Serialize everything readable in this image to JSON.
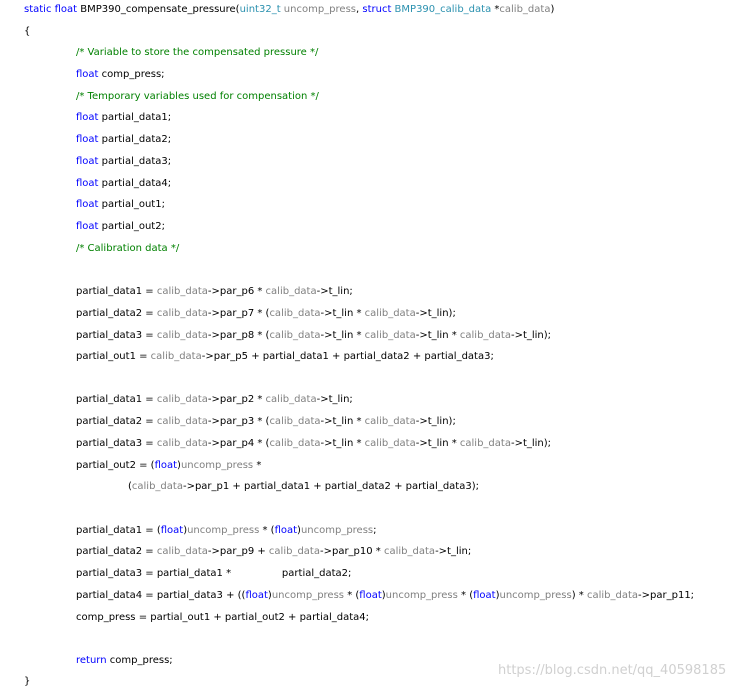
{
  "colors": {
    "keyword": "#0000ff",
    "type": "#2b91af",
    "variable": "#808080",
    "comment": "#008000",
    "text": "#000000",
    "watermark": "#d0d0d0"
  },
  "code_lines": [
    [
      [
        "kw",
        "static float "
      ],
      [
        "tx",
        "BMP390_compensate_pressure("
      ],
      [
        "ty",
        "uint32_t"
      ],
      [
        "vr",
        " uncomp_press"
      ],
      [
        "tx",
        ", "
      ],
      [
        "kw",
        "struct "
      ],
      [
        "ty",
        "BMP390_calib_data"
      ],
      [
        "tx",
        " *"
      ],
      [
        "vr",
        "calib_data"
      ],
      [
        "tx",
        ")"
      ]
    ],
    [
      [
        "tx",
        "{"
      ]
    ],
    [
      [
        "cm",
        "/* Variable to store the compensated pressure */"
      ]
    ],
    [
      [
        "kw",
        "float "
      ],
      [
        "tx",
        "comp_press;"
      ]
    ],
    [
      [
        "cm",
        "/* Temporary variables used for compensation */"
      ]
    ],
    [
      [
        "kw",
        "float "
      ],
      [
        "tx",
        "partial_data1;"
      ]
    ],
    [
      [
        "kw",
        "float "
      ],
      [
        "tx",
        "partial_data2;"
      ]
    ],
    [
      [
        "kw",
        "float "
      ],
      [
        "tx",
        "partial_data3;"
      ]
    ],
    [
      [
        "kw",
        "float "
      ],
      [
        "tx",
        "partial_data4;"
      ]
    ],
    [
      [
        "kw",
        "float "
      ],
      [
        "tx",
        "partial_out1;"
      ]
    ],
    [
      [
        "kw",
        "float "
      ],
      [
        "tx",
        "partial_out2;"
      ]
    ],
    [
      [
        "cm",
        "/* Calibration data */"
      ]
    ],
    [
      [
        "tx",
        "partial_data1 = "
      ],
      [
        "vr",
        "calib_data"
      ],
      [
        "tx",
        "->par_p6 * "
      ],
      [
        "vr",
        "calib_data"
      ],
      [
        "tx",
        "->t_lin;"
      ]
    ],
    [
      [
        "tx",
        "partial_data2 = "
      ],
      [
        "vr",
        "calib_data"
      ],
      [
        "tx",
        "->par_p7 * ("
      ],
      [
        "vr",
        "calib_data"
      ],
      [
        "tx",
        "->t_lin * "
      ],
      [
        "vr",
        "calib_data"
      ],
      [
        "tx",
        "->t_lin);"
      ]
    ],
    [
      [
        "tx",
        "partial_data3 = "
      ],
      [
        "vr",
        "calib_data"
      ],
      [
        "tx",
        "->par_p8 * ("
      ],
      [
        "vr",
        "calib_data"
      ],
      [
        "tx",
        "->t_lin * "
      ],
      [
        "vr",
        "calib_data"
      ],
      [
        "tx",
        "->t_lin * "
      ],
      [
        "vr",
        "calib_data"
      ],
      [
        "tx",
        "->t_lin);"
      ]
    ],
    [
      [
        "tx",
        "partial_out1 = "
      ],
      [
        "vr",
        "calib_data"
      ],
      [
        "tx",
        "->par_p5 + partial_data1 + partial_data2 + partial_data3;"
      ]
    ],
    [
      [
        "tx",
        "partial_data1 = "
      ],
      [
        "vr",
        "calib_data"
      ],
      [
        "tx",
        "->par_p2 * "
      ],
      [
        "vr",
        "calib_data"
      ],
      [
        "tx",
        "->t_lin;"
      ]
    ],
    [
      [
        "tx",
        "partial_data2 = "
      ],
      [
        "vr",
        "calib_data"
      ],
      [
        "tx",
        "->par_p3 * ("
      ],
      [
        "vr",
        "calib_data"
      ],
      [
        "tx",
        "->t_lin * "
      ],
      [
        "vr",
        "calib_data"
      ],
      [
        "tx",
        "->t_lin);"
      ]
    ],
    [
      [
        "tx",
        "partial_data3 = "
      ],
      [
        "vr",
        "calib_data"
      ],
      [
        "tx",
        "->par_p4 * ("
      ],
      [
        "vr",
        "calib_data"
      ],
      [
        "tx",
        "->t_lin * "
      ],
      [
        "vr",
        "calib_data"
      ],
      [
        "tx",
        "->t_lin * "
      ],
      [
        "vr",
        "calib_data"
      ],
      [
        "tx",
        "->t_lin);"
      ]
    ],
    [
      [
        "tx",
        "partial_out2 = ("
      ],
      [
        "kw",
        "float"
      ],
      [
        "tx",
        ")"
      ],
      [
        "vr",
        "uncomp_press"
      ],
      [
        "tx",
        " *"
      ]
    ],
    [
      [
        "tx",
        "("
      ],
      [
        "vr",
        "calib_data"
      ],
      [
        "tx",
        "->par_p1 + partial_data1 + partial_data2 + partial_data3);"
      ]
    ],
    [
      [
        "tx",
        "partial_data1 = ("
      ],
      [
        "kw",
        "float"
      ],
      [
        "tx",
        ")"
      ],
      [
        "vr",
        "uncomp_press"
      ],
      [
        "tx",
        " * ("
      ],
      [
        "kw",
        "float"
      ],
      [
        "tx",
        ")"
      ],
      [
        "vr",
        "uncomp_press"
      ],
      [
        "tx",
        ";"
      ]
    ],
    [
      [
        "tx",
        "partial_data2 = "
      ],
      [
        "vr",
        "calib_data"
      ],
      [
        "tx",
        "->par_p9 + "
      ],
      [
        "vr",
        "calib_data"
      ],
      [
        "tx",
        "->par_p10 * "
      ],
      [
        "vr",
        "calib_data"
      ],
      [
        "tx",
        "->t_lin;"
      ]
    ],
    [
      [
        "tx",
        "partial_data3 = partial_data1 *                partial_data2;"
      ]
    ],
    [
      [
        "tx",
        "partial_data4 = partial_data3 + (("
      ],
      [
        "kw",
        "float"
      ],
      [
        "tx",
        ")"
      ],
      [
        "vr",
        "uncomp_press"
      ],
      [
        "tx",
        " * ("
      ],
      [
        "kw",
        "float"
      ],
      [
        "tx",
        ")"
      ],
      [
        "vr",
        "uncomp_press"
      ],
      [
        "tx",
        " * ("
      ],
      [
        "kw",
        "float"
      ],
      [
        "tx",
        ")"
      ],
      [
        "vr",
        "uncomp_press"
      ],
      [
        "tx",
        ") * "
      ],
      [
        "vr",
        "calib_data"
      ],
      [
        "tx",
        "->par_p11;"
      ]
    ],
    [
      [
        "tx",
        "comp_press = partial_out1 + partial_out2 + partial_data4;"
      ]
    ],
    [
      [
        "kw",
        "return "
      ],
      [
        "tx",
        "comp_press;"
      ]
    ],
    [
      [
        "tx",
        "}"
      ]
    ]
  ],
  "watermark": "https://blog.csdn.net/qq_40598185"
}
